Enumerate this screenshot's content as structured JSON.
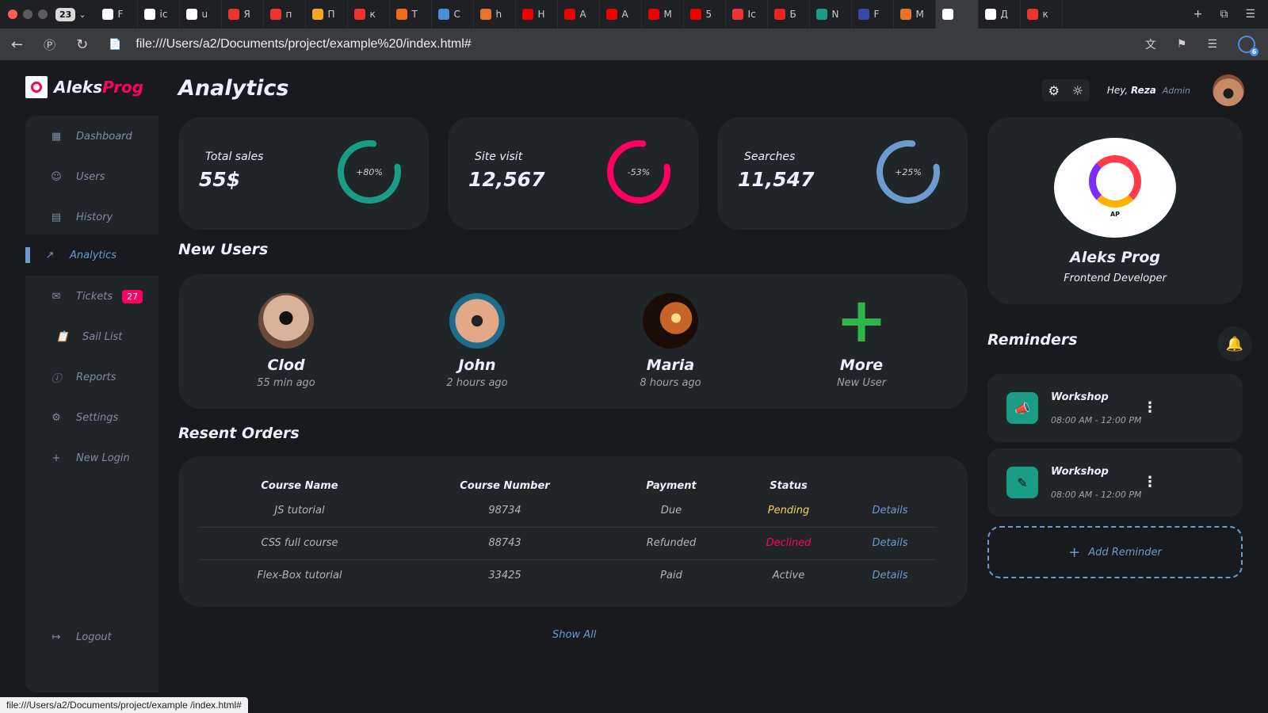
{
  "browser": {
    "tab_count": "23",
    "tabs": [
      "F",
      "ic",
      "u",
      "Я",
      "п",
      "П",
      "к",
      "Т",
      "С",
      "h",
      "Н",
      "А",
      "А",
      "М",
      "5",
      "Ic",
      "Б",
      "N",
      "F",
      "M",
      "",
      "Д",
      "к"
    ],
    "url": "file:///Users/a2/Documents/project/example%20/index.html#",
    "download_count": "6",
    "status_url": "file:///Users/a2/Documents/project/example /index.html#"
  },
  "logo": {
    "prefix": "Aleks",
    "accent": "Prog"
  },
  "sidebar": {
    "items": [
      {
        "label": "Dashboard",
        "icon": "grid-icon"
      },
      {
        "label": "Users",
        "icon": "user-icon"
      },
      {
        "label": "History",
        "icon": "receipt-icon"
      },
      {
        "label": "Analytics",
        "icon": "trending-icon"
      },
      {
        "label": "Tickets",
        "icon": "mail-icon",
        "badge": "27"
      },
      {
        "label": "Sail List",
        "icon": "clipboard-icon"
      },
      {
        "label": "Reports",
        "icon": "alert-icon"
      },
      {
        "label": "Settings",
        "icon": "gear-icon"
      },
      {
        "label": "New Login",
        "icon": "plus-icon"
      }
    ],
    "logout": "Logout"
  },
  "page_title": "Analytics",
  "stats": [
    {
      "label": "Total sales",
      "value": "55$",
      "percent": "+80%",
      "fraction": 0.8,
      "color": "#1b9c85"
    },
    {
      "label": "Site visit",
      "value": "12,567",
      "percent": "-53%",
      "fraction": 0.8,
      "color": "#ff0060"
    },
    {
      "label": "Searches",
      "value": "11,547",
      "percent": "+25%",
      "fraction": 0.8,
      "color": "#6c9bcf"
    }
  ],
  "new_users": {
    "title": "New Users",
    "users": [
      {
        "name": "Clod",
        "time": "55 min ago"
      },
      {
        "name": "John",
        "time": "2 hours ago"
      },
      {
        "name": "Maria",
        "time": "8 hours ago"
      },
      {
        "name": "More",
        "time": "New User"
      }
    ]
  },
  "orders": {
    "title": "Resent Orders",
    "headers": [
      "Course Name",
      "Course Number",
      "Payment",
      "Status",
      ""
    ],
    "rows": [
      [
        "JS tutorial",
        "98734",
        "Due",
        "Pending",
        "Details"
      ],
      [
        "CSS full course",
        "88743",
        "Refunded",
        "Declined",
        "Details"
      ],
      [
        "Flex-Box tutorial",
        "33425",
        "Paid",
        "Active",
        "Details"
      ]
    ],
    "show_all": "Show All"
  },
  "header": {
    "greeting": "Hey,",
    "user": "Reza",
    "role": "Admin"
  },
  "profile": {
    "name": "Aleks Prog",
    "role": "Frontend Developer",
    "logo_text": "AP"
  },
  "reminders": {
    "title": "Reminders",
    "items": [
      {
        "title": "Workshop",
        "time": "08:00 AM - 12:00 PM",
        "icon": "megaphone-icon"
      },
      {
        "title": "Workshop",
        "time": "08:00 AM - 12:00 PM",
        "icon": "pencil-icon"
      }
    ],
    "add_label": "Add Reminder"
  },
  "colors": {
    "accent": "#6c9bcf",
    "danger": "#ff0060",
    "success": "#1b9c85",
    "warning": "#f7d060",
    "background": "#181a1e",
    "card": "#202528"
  }
}
